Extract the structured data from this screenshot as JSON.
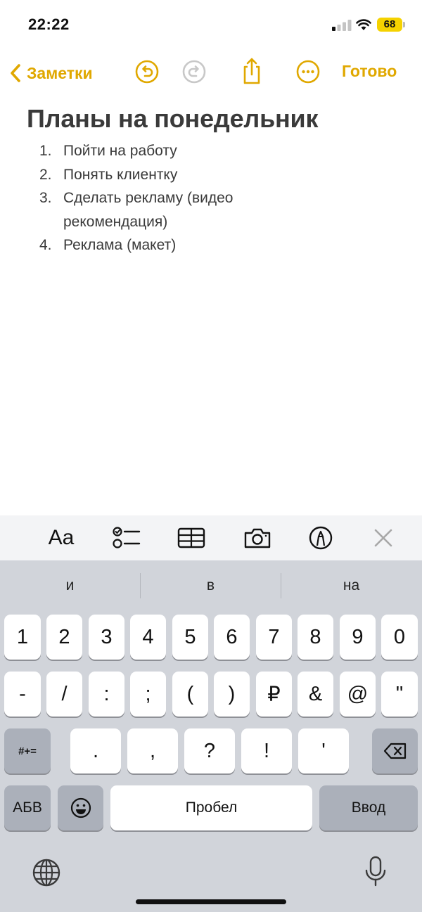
{
  "status_bar": {
    "time": "22:22",
    "battery": "68"
  },
  "nav": {
    "back_label": "Заметки",
    "done_label": "Готово"
  },
  "note": {
    "title": "Планы на понедельник",
    "items": [
      {
        "num": "1.",
        "text": "Пойти на работу"
      },
      {
        "num": "2.",
        "text": "Понять клиентку"
      },
      {
        "num": "3.",
        "text": "Сделать рекламу (видео рекомендация)"
      },
      {
        "num": "4.",
        "text": "Реклама (макет)"
      }
    ]
  },
  "format_bar": {
    "text_style_label": "Aa"
  },
  "keyboard": {
    "suggestions": [
      "и",
      "в",
      "на"
    ],
    "row1": [
      "1",
      "2",
      "3",
      "4",
      "5",
      "6",
      "7",
      "8",
      "9",
      "0"
    ],
    "row2": [
      "-",
      "/",
      ":",
      ";",
      "(",
      ")",
      "₽",
      "&",
      "@",
      "\""
    ],
    "row3": {
      "symbols_label": "#+=",
      "keys": [
        ".",
        ",",
        "?",
        "!",
        "'"
      ]
    },
    "row4": {
      "abc_label": "АБВ",
      "space_label": "Пробел",
      "return_label": "Ввод"
    }
  },
  "colors": {
    "accent": "#e0a800",
    "keyboard_bg": "#d1d4da",
    "battery": "#f5d200"
  }
}
